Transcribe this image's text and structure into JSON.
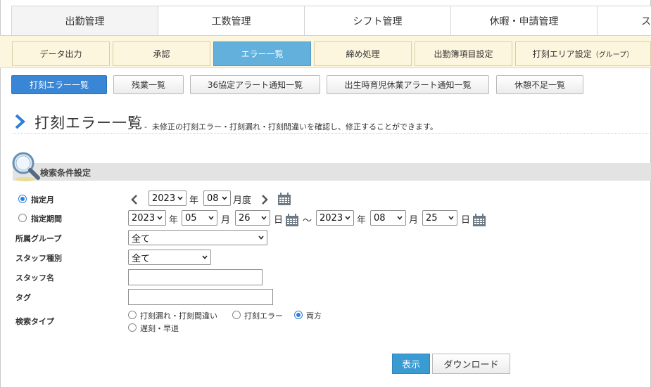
{
  "top_tabs": [
    "出勤管理",
    "工数管理",
    "シフト管理",
    "休暇・申請管理",
    "ス"
  ],
  "sub_tabs": [
    "データ出力",
    "承認",
    "エラー一覧",
    "締め処理",
    "出勤簿項目設定",
    "打刻エリア設定",
    "（グループ）"
  ],
  "row_buttons": [
    "打刻エラー一覧",
    "残業一覧",
    "36協定アラート通知一覧",
    "出生時育児休業アラート通知一覧",
    "休憩不足一覧"
  ],
  "page": {
    "title": "打刻エラー一覧",
    "separator": "-",
    "description": "未修正の打刻エラー・打刻漏れ・打刻間違いを確認し、修正することができます。"
  },
  "search": {
    "section_title": "検索条件設定",
    "month_label": "指定月",
    "month_year": "2023",
    "month_year_unit": "年",
    "month_month": "08",
    "month_unit": "月度",
    "period_label": "指定期間",
    "from_year": "2023",
    "from_month": "05",
    "from_day": "26",
    "to_year": "2023",
    "to_month": "08",
    "to_day": "25",
    "year_unit": "年",
    "month_unit2": "月",
    "day_unit": "日",
    "tilde": "～",
    "group_label": "所属グループ",
    "group_value": "全て",
    "staff_type_label": "スタッフ種別",
    "staff_type_value": "全て",
    "staff_name_label": "スタッフ名",
    "tag_label": "タグ",
    "search_type_label": "検索タイプ",
    "options": [
      "打刻漏れ・打刻間違い",
      "打刻エラー",
      "両方",
      "遅刻・早退"
    ]
  },
  "buttons": {
    "show": "表示",
    "download": "ダウンロード"
  },
  "colors": {
    "active_sub_tab": "#62b0db",
    "active_row_button": "#3a86d6",
    "primary_button": "#3a9ad2",
    "accent_chevron": "#2f7fd8"
  }
}
